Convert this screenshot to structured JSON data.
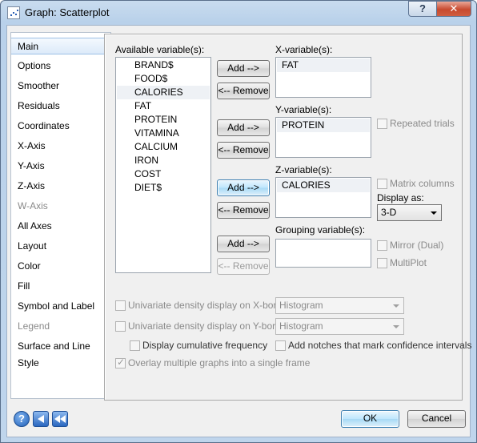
{
  "window": {
    "title": "Graph: Scatterplot",
    "help_glyph": "?",
    "close_glyph": "✕"
  },
  "sidebar": {
    "items": [
      {
        "label": "Main",
        "state": "selected"
      },
      {
        "label": "Options",
        "state": "normal"
      },
      {
        "label": "Smoother",
        "state": "normal"
      },
      {
        "label": "Residuals",
        "state": "normal"
      },
      {
        "label": "Coordinates",
        "state": "normal"
      },
      {
        "label": "X-Axis",
        "state": "normal"
      },
      {
        "label": "Y-Axis",
        "state": "normal"
      },
      {
        "label": "Z-Axis",
        "state": "normal"
      },
      {
        "label": "W-Axis",
        "state": "disabled"
      },
      {
        "label": "All Axes",
        "state": "normal"
      },
      {
        "label": "Layout",
        "state": "normal"
      },
      {
        "label": "Color",
        "state": "normal"
      },
      {
        "label": "Fill",
        "state": "normal"
      },
      {
        "label": "Symbol and Label",
        "state": "normal"
      },
      {
        "label": "Legend",
        "state": "disabled"
      },
      {
        "label": "Surface and Line Style",
        "state": "normal"
      }
    ]
  },
  "available": {
    "label": "Available variable(s):",
    "items": [
      "BRAND$",
      "FOOD$",
      "CALORIES",
      "FAT",
      "PROTEIN",
      "VITAMINA",
      "CALCIUM",
      "IRON",
      "COST",
      "DIET$"
    ],
    "highlighted_index": 2
  },
  "buttons": {
    "add": "Add -->",
    "remove": "<-- Remove",
    "ok": "OK",
    "cancel": "Cancel"
  },
  "x_variable": {
    "label": "X-variable(s):",
    "value": "FAT"
  },
  "y_variable": {
    "label": "Y-variable(s):",
    "value": "PROTEIN"
  },
  "z_variable": {
    "label": "Z-variable(s):",
    "value": "CALORIES"
  },
  "grouping": {
    "label": "Grouping variable(s):"
  },
  "options": {
    "repeated_trials": "Repeated trials",
    "matrix_columns": "Matrix columns",
    "display_as_label": "Display as:",
    "display_as_value": "3-D",
    "mirror_dual": "Mirror (Dual)",
    "multiplot": "MultiPlot"
  },
  "density": {
    "x_border_label": "Univariate density display on X-border",
    "x_border_value": "Histogram",
    "y_border_label": "Univariate density display on Y-border",
    "y_border_value": "Histogram",
    "cumulative": "Display cumulative frequency",
    "notches": "Add notches that mark confidence intervals",
    "overlay": "Overlay multiple graphs into a single frame"
  }
}
